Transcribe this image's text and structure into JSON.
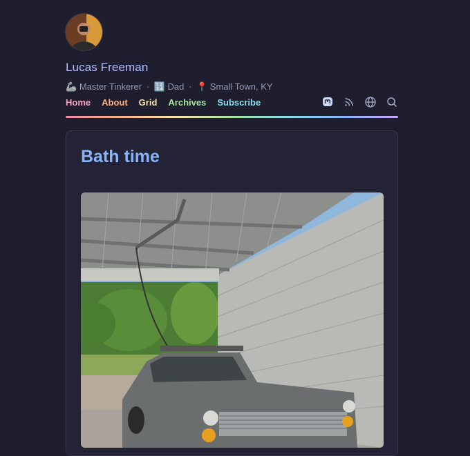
{
  "profile": {
    "name": "Lucas Freeman",
    "tagline": {
      "item1_icon": "🦾",
      "item1": "Master Tinkerer",
      "item2_icon": "🔢",
      "item2": "Dad",
      "item3_icon": "📍",
      "item3": "Small Town, KY",
      "separator": "·"
    }
  },
  "nav": {
    "items": [
      {
        "label": "Home",
        "color": "#f5a3c7"
      },
      {
        "label": "About",
        "color": "#fab387"
      },
      {
        "label": "Grid",
        "color": "#f9e2af"
      },
      {
        "label": "Archives",
        "color": "#a6e3a1"
      },
      {
        "label": "Subscribe",
        "color": "#89dceb"
      }
    ],
    "icons": [
      "mastodon-icon",
      "rss-icon",
      "globe-icon",
      "search-icon"
    ]
  },
  "post": {
    "title": "Bath time",
    "image_icon": "photo-car-under-carport"
  },
  "colors": {
    "background": "#1e1e2e",
    "card": "#232335",
    "title": "#89b4fa",
    "name": "#b4befe",
    "muted": "#9399b2"
  }
}
